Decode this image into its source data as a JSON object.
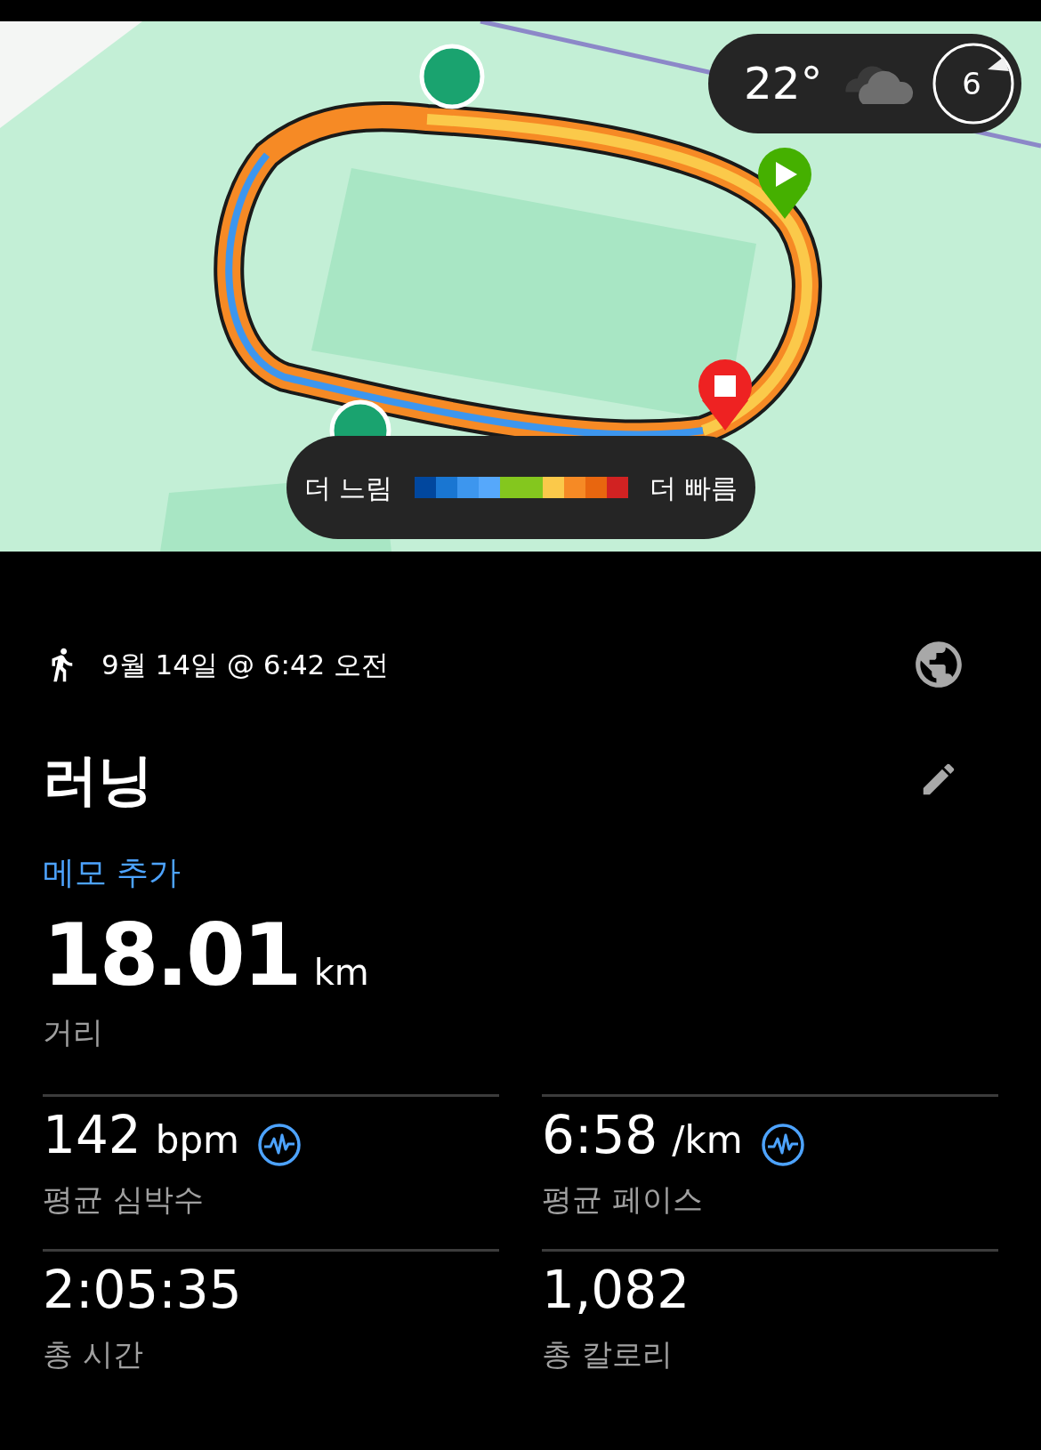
{
  "map": {
    "kind": "picture",
    "weather": {
      "temperature": "22°",
      "uv_index": "6"
    },
    "legend": {
      "slower": "더 느림",
      "faster": "더 빠름",
      "swatches": [
        {
          "color": "#01479e"
        },
        {
          "color": "#1976d2"
        },
        {
          "color": "#3d96ee"
        },
        {
          "color": "#56a8fb"
        },
        {
          "color": "#84c71e"
        },
        {
          "color": "#84c71e"
        },
        {
          "color": "#fbc94a"
        },
        {
          "color": "#f68a25"
        },
        {
          "color": "#e8660f"
        },
        {
          "color": "#d12222"
        }
      ]
    }
  },
  "activity": {
    "datetime": "9월 14일 @ 6:42 오전",
    "title": "러닝",
    "add_memo": "메모 추가",
    "distance": {
      "value": "18.01",
      "unit": "km",
      "label": "거리"
    }
  },
  "stats": [
    {
      "value": "142",
      "unit": "bpm",
      "label": "평균 심박수",
      "has_chart_icon": true
    },
    {
      "value": "6:58",
      "unit": "/km",
      "label": "평균 페이스",
      "has_chart_icon": true
    },
    {
      "value": "2:05:35",
      "label": "총 시간",
      "has_chart_icon": false
    },
    {
      "value": "1,082",
      "label": "총 칼로리",
      "has_chart_icon": false
    }
  ]
}
